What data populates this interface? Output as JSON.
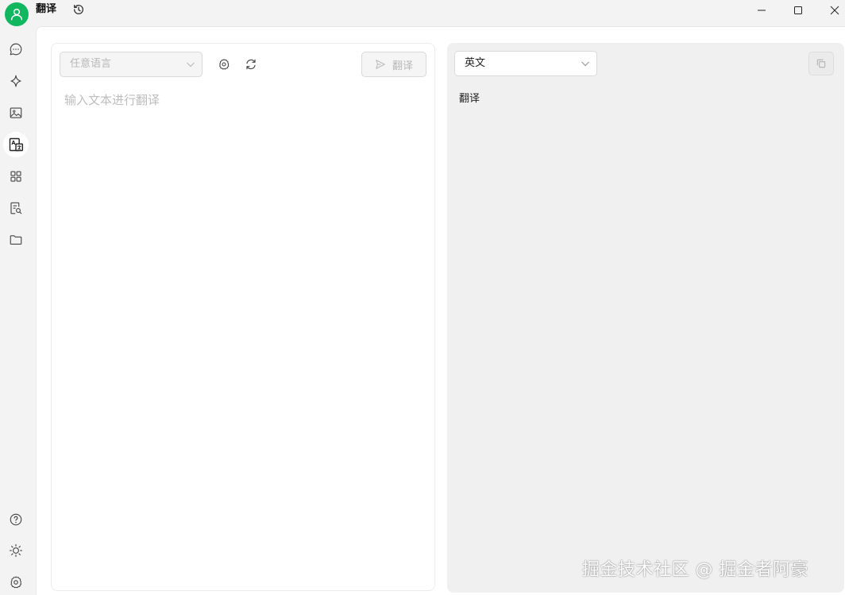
{
  "app": {
    "title": "翻译",
    "accent_color": "#10b75e"
  },
  "window_controls": {
    "minimize_icon": "minimize-icon",
    "maximize_icon": "maximize-icon",
    "close_icon": "close-icon"
  },
  "sidebar": {
    "items": [
      {
        "icon": "chat-bubble-icon"
      },
      {
        "icon": "sparkle-icon"
      },
      {
        "icon": "image-icon"
      },
      {
        "icon": "translate-icon",
        "active": true
      },
      {
        "icon": "grid-apps-icon"
      },
      {
        "icon": "document-search-icon"
      },
      {
        "icon": "folder-icon"
      }
    ],
    "bottom_items": [
      {
        "icon": "help-icon"
      },
      {
        "icon": "sun-theme-icon"
      },
      {
        "icon": "gear-icon"
      }
    ]
  },
  "source": {
    "language_select": "任意语言",
    "settings_icon": "gear-icon",
    "swap_icon": "refresh-icon",
    "translate_button": "翻译",
    "input_placeholder": "输入文本进行翻译",
    "input_value": ""
  },
  "target": {
    "language_select": "英文",
    "copy_icon": "copy-icon",
    "output_text": "翻译"
  },
  "watermark": "掘金技术社区 @ 掘金者阿豪"
}
